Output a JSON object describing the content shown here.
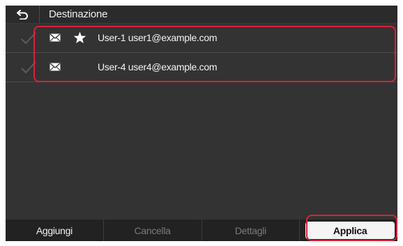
{
  "header": {
    "title": "Destinazione",
    "back_icon": "back-arrow-icon"
  },
  "destinations": [
    {
      "label": "User-1 user1@example.com",
      "type_icon": "envelope-icon",
      "favorite": true,
      "checked": true
    },
    {
      "label": "User-4 user4@example.com",
      "type_icon": "envelope-icon",
      "favorite": false,
      "checked": true
    }
  ],
  "footer": {
    "add_label": "Aggiungi",
    "delete_label": "Cancella",
    "details_label": "Dettagli",
    "apply_label": "Applica"
  },
  "colors": {
    "screen_bg": "#333333",
    "highlight": "#d9213a",
    "apply_bg": "#f4f4f4",
    "disabled_text": "#7a7a7a"
  }
}
